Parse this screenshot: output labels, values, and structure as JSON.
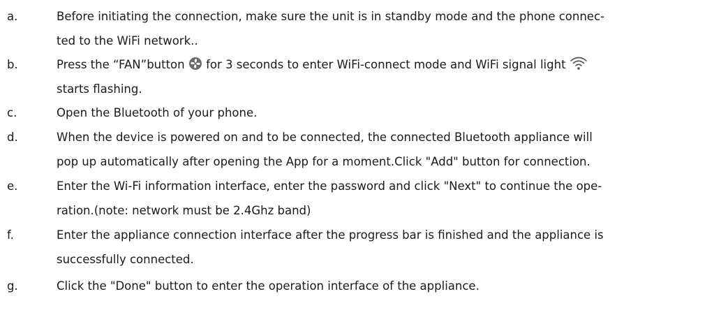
{
  "instructions": {
    "items": [
      {
        "letter": "a.",
        "lines": [
          "Before initiating the connection, make sure the unit is in standby mode and the phone connec-",
          "ted to the WiFi network.."
        ]
      },
      {
        "letter": "b.",
        "line1_part1": "Press the “FAN”button",
        "line1_part2": "for 3 seconds to enter WiFi-connect mode and WiFi signal light",
        "line2": "starts flashing.",
        "icons": [
          "fan-icon",
          "wifi-signal-icon"
        ]
      },
      {
        "letter": "c.",
        "lines": [
          "Open the Bluetooth of your phone."
        ]
      },
      {
        "letter": "d.",
        "lines": [
          "When the device is powered on and to be connected, the connected Bluetooth appliance will",
          "pop up automatically after opening the App for a moment.Click \"Add\" button for connection."
        ]
      },
      {
        "letter": "e.",
        "lines": [
          "Enter the Wi-Fi information interface, enter the password and click \"Next\" to continue the ope-",
          "ration.(note: network must be 2.4Ghz band)"
        ]
      },
      {
        "letter": "f.",
        "lines": [
          "Enter the appliance connection interface after the progress bar is finished and the appliance is",
          "successfully connected."
        ]
      },
      {
        "letter": "g.",
        "lines": [
          "Click the \"Done\" button to enter the operation interface of the appliance."
        ]
      }
    ]
  }
}
